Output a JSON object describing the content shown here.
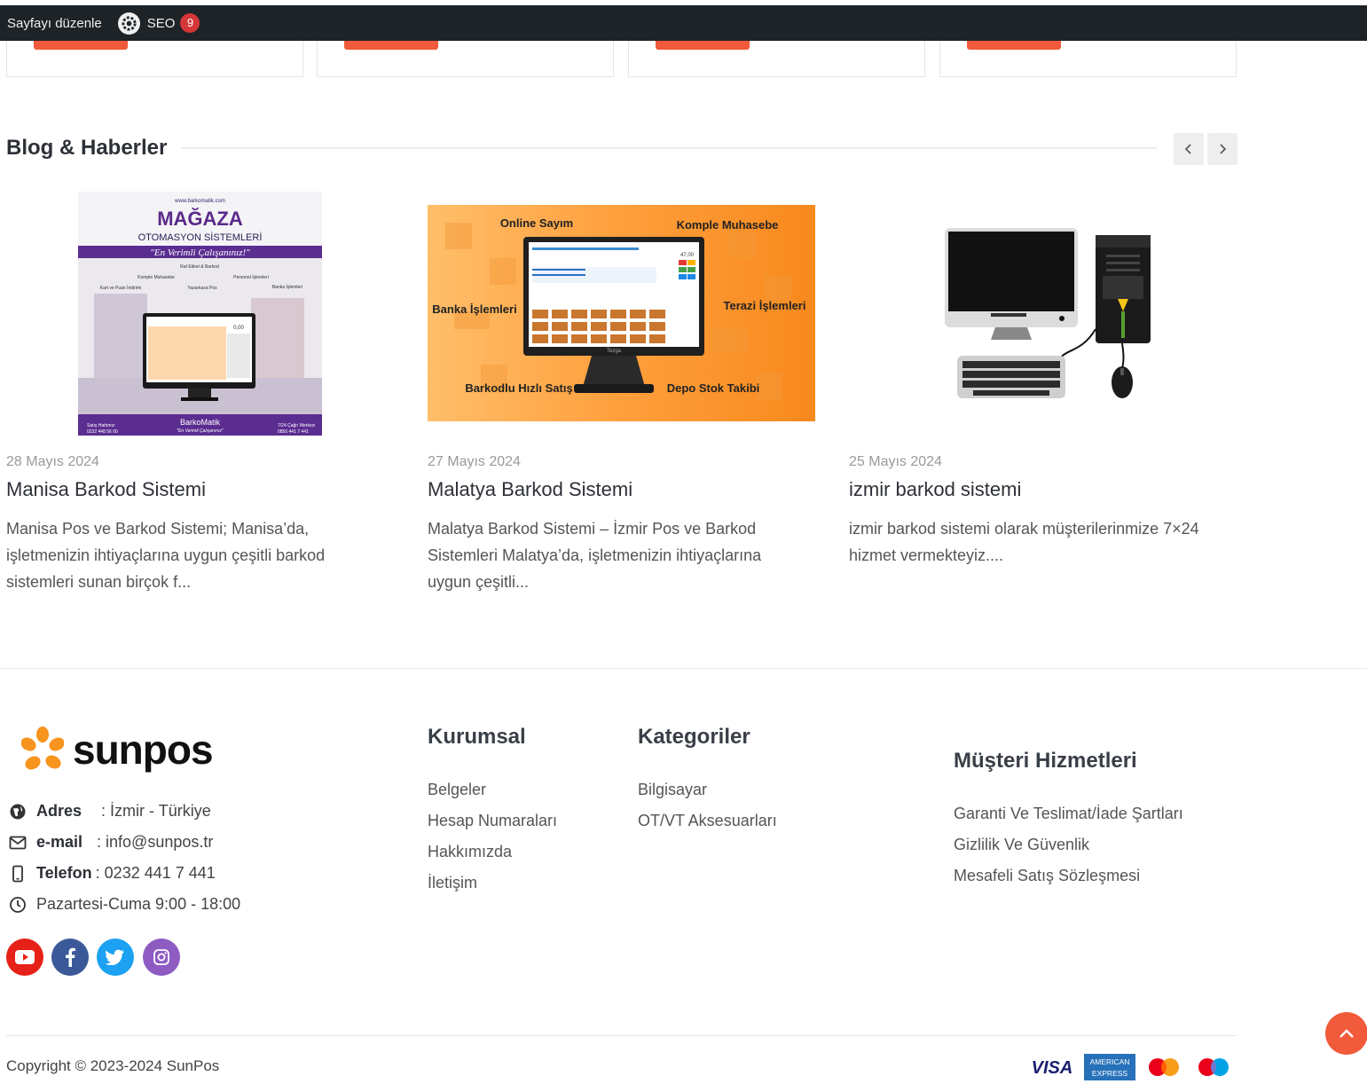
{
  "admin_bar": {
    "edit_page": "Sayfayı düzenle",
    "seo_label": "SEO",
    "seo_count": "9"
  },
  "blog": {
    "title": "Blog & Haberler",
    "posts": [
      {
        "date": "28 Mayıs 2024",
        "title": "Manisa Barkod Sistemi",
        "excerpt": "Manisa Pos ve Barkod Sistemi; Manisa’da, işletmenizin ihtiyaçlarına uygun çeşitli barkod sistemleri sunan birçok f...",
        "image_text": {
          "site": "www.barkomatik.com",
          "headline": "MAĞAZA",
          "sub": "OTOMASYON SİSTEMLERİ",
          "slogan": "\"En Verimli Çalışanınız!\"",
          "features": [
            "Raf Etiket & Barkod",
            "Komple Muhasebe",
            "Personel İşlemleri",
            "Kart ve Puan İndirimi",
            "Yazarkasa Pos",
            "Banka İşlemleri"
          ],
          "brand": "BarkoMatik",
          "brand_slogan": "\"En Verimli Çalışanınız\"",
          "sales_label": "Satış Hattımız",
          "sales_phone": "0232 448 56 00",
          "support_label": "7/24 Çağrı Merkezi",
          "support_phone": "0850 441 7 441",
          "screen_total": "0,00"
        }
      },
      {
        "date": "27 Mayıs 2024",
        "title": "Malatya Barkod Sistemi",
        "excerpt": "Malatya Barkod Sistemi – İzmir Pos ve Barkod Sistemleri Malatya’da, işletmenizin ihtiyaçlarına uygun çeşitli...",
        "image_text": {
          "labels": [
            "Online Sayım",
            "Komple Muhasebe",
            "Banka İşlemleri",
            "Terazi İşlemleri",
            "Barkodlu Hızlı Satış",
            "Depo Stok Takibi"
          ],
          "device_brand": "Tezga",
          "screen_total": "47,00"
        }
      },
      {
        "date": "25 Mayıs 2024",
        "title": "izmir barkod sistemi",
        "excerpt": "izmir barkod sistemi olarak müşterilerinmize 7×24 hizmet vermekteyiz....",
        "image_text": {}
      }
    ]
  },
  "footer": {
    "brand": "sunpos",
    "contact": {
      "address_label": "Adres",
      "address_value": ": İzmir - Türkiye",
      "email_label": "e-mail",
      "email_value": ": info@sunpos.tr",
      "phone_label": "Telefon",
      "phone_value": ": 0232 441 7 441",
      "hours": "Pazartesi-Cuma 9:00 - 18:00"
    },
    "social": [
      {
        "name": "youtube",
        "color": "#e62117"
      },
      {
        "name": "facebook",
        "color": "#3b5998"
      },
      {
        "name": "twitter",
        "color": "#1da1f2"
      },
      {
        "name": "instagram",
        "color": "#8e5bc2"
      }
    ],
    "kurumsal": {
      "title": "Kurumsal",
      "links": [
        "Belgeler",
        "Hesap Numaraları",
        "Hakkımızda",
        "İletişim"
      ]
    },
    "kategoriler": {
      "title": "Kategoriler",
      "links": [
        "Bilgisayar",
        "OT/VT Aksesuarları"
      ]
    },
    "musteri": {
      "title": "Müşteri Hizmetleri",
      "links": [
        "Garanti Ve Teslimat/İade Şartları",
        "Gizlilik Ve Güvenlik",
        "Mesafeli Satış Sözleşmesi"
      ]
    },
    "copyright": "Copyright © 2023-2024 SunPos",
    "payments": {
      "visa": "VISA",
      "amex_top": "AMERICAN",
      "amex_bottom": "EXPRESS"
    }
  },
  "colors": {
    "accent": "#f15a3a",
    "admin_bar": "#1d2327",
    "heading": "#2d3037",
    "logo_orange": "#f7941d"
  }
}
